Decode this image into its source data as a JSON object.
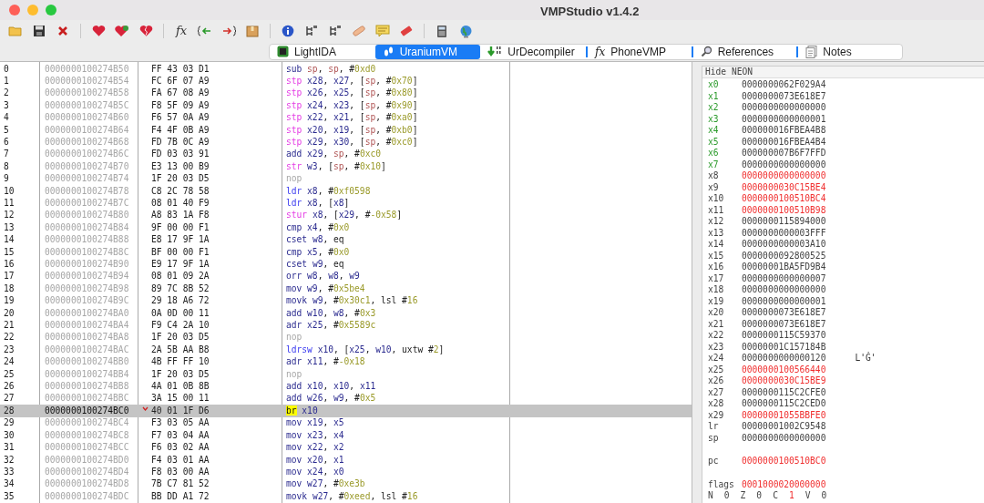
{
  "window": {
    "title": "VMPStudio v1.4.2"
  },
  "toolbar": [
    [
      {
        "kind": "folder"
      },
      {
        "kind": "save"
      },
      {
        "kind": "close"
      }
    ],
    [
      {
        "kind": "heart"
      },
      {
        "kind": "heart-flower"
      },
      {
        "kind": "heart-broken"
      }
    ],
    [
      {
        "kind": "fx",
        "label": "fx"
      },
      {
        "kind": "brace-left"
      },
      {
        "kind": "brace-right"
      },
      {
        "kind": "box"
      }
    ],
    [
      {
        "kind": "info"
      },
      {
        "kind": "tree"
      },
      {
        "kind": "tree"
      },
      {
        "kind": "bandage"
      },
      {
        "kind": "note"
      },
      {
        "kind": "eraser"
      }
    ],
    [
      {
        "kind": "calculator"
      },
      {
        "kind": "globe"
      }
    ]
  ],
  "tabs": [
    {
      "label": "LightIDA",
      "selected": false
    },
    {
      "label": "UraniumVM",
      "selected": true
    },
    {
      "label": "UrDecompiler",
      "selected": false
    },
    {
      "label": "PhoneVMP",
      "icon_text": "fx",
      "selected": false
    },
    {
      "label": "References",
      "selected": false
    },
    {
      "label": "Notes",
      "selected": false
    }
  ],
  "rows": [
    {
      "index": "0",
      "address": "0000000100274B50",
      "bytes": "FF 43 03 D1",
      "mnemonic": "sub",
      "kind": "alu",
      "args": [
        {
          "kind": "sp",
          "text": "sp"
        },
        {
          "kind": "p",
          "text": ", "
        },
        {
          "kind": "sp",
          "text": "sp"
        },
        {
          "kind": "p",
          "text": ", #"
        },
        {
          "kind": "imm",
          "text": "0xd0"
        }
      ],
      "selected": false
    },
    {
      "index": "1",
      "address": "0000000100274B54",
      "bytes": "FC 6F 07 A9",
      "mnemonic": "stp",
      "kind": "store",
      "args": [
        {
          "kind": "reg",
          "text": "x28"
        },
        {
          "kind": "p",
          "text": ", "
        },
        {
          "kind": "reg",
          "text": "x27"
        },
        {
          "kind": "p",
          "text": ", ["
        },
        {
          "kind": "sp",
          "text": "sp"
        },
        {
          "kind": "p",
          "text": ", #"
        },
        {
          "kind": "imm",
          "text": "0x70"
        },
        {
          "kind": "p",
          "text": "]"
        }
      ],
      "selected": false
    },
    {
      "index": "2",
      "address": "0000000100274B58",
      "bytes": "FA 67 08 A9",
      "mnemonic": "stp",
      "kind": "store",
      "args": [
        {
          "kind": "reg",
          "text": "x26"
        },
        {
          "kind": "p",
          "text": ", "
        },
        {
          "kind": "reg",
          "text": "x25"
        },
        {
          "kind": "p",
          "text": ", ["
        },
        {
          "kind": "sp",
          "text": "sp"
        },
        {
          "kind": "p",
          "text": ", #"
        },
        {
          "kind": "imm",
          "text": "0x80"
        },
        {
          "kind": "p",
          "text": "]"
        }
      ],
      "selected": false
    },
    {
      "index": "3",
      "address": "0000000100274B5C",
      "bytes": "F8 5F 09 A9",
      "mnemonic": "stp",
      "kind": "store",
      "args": [
        {
          "kind": "reg",
          "text": "x24"
        },
        {
          "kind": "p",
          "text": ", "
        },
        {
          "kind": "reg",
          "text": "x23"
        },
        {
          "kind": "p",
          "text": ", ["
        },
        {
          "kind": "sp",
          "text": "sp"
        },
        {
          "kind": "p",
          "text": ", #"
        },
        {
          "kind": "imm",
          "text": "0x90"
        },
        {
          "kind": "p",
          "text": "]"
        }
      ],
      "selected": false
    },
    {
      "index": "4",
      "address": "0000000100274B60",
      "bytes": "F6 57 0A A9",
      "mnemonic": "stp",
      "kind": "store",
      "args": [
        {
          "kind": "reg",
          "text": "x22"
        },
        {
          "kind": "p",
          "text": ", "
        },
        {
          "kind": "reg",
          "text": "x21"
        },
        {
          "kind": "p",
          "text": ", ["
        },
        {
          "kind": "sp",
          "text": "sp"
        },
        {
          "kind": "p",
          "text": ", #"
        },
        {
          "kind": "imm",
          "text": "0xa0"
        },
        {
          "kind": "p",
          "text": "]"
        }
      ],
      "selected": false
    },
    {
      "index": "5",
      "address": "0000000100274B64",
      "bytes": "F4 4F 0B A9",
      "mnemonic": "stp",
      "kind": "store",
      "args": [
        {
          "kind": "reg",
          "text": "x20"
        },
        {
          "kind": "p",
          "text": ", "
        },
        {
          "kind": "reg",
          "text": "x19"
        },
        {
          "kind": "p",
          "text": ", ["
        },
        {
          "kind": "sp",
          "text": "sp"
        },
        {
          "kind": "p",
          "text": ", #"
        },
        {
          "kind": "imm",
          "text": "0xb0"
        },
        {
          "kind": "p",
          "text": "]"
        }
      ],
      "selected": false
    },
    {
      "index": "6",
      "address": "0000000100274B68",
      "bytes": "FD 7B 0C A9",
      "mnemonic": "stp",
      "kind": "store",
      "args": [
        {
          "kind": "reg",
          "text": "x29"
        },
        {
          "kind": "p",
          "text": ", "
        },
        {
          "kind": "reg",
          "text": "x30"
        },
        {
          "kind": "p",
          "text": ", ["
        },
        {
          "kind": "sp",
          "text": "sp"
        },
        {
          "kind": "p",
          "text": ", #"
        },
        {
          "kind": "imm",
          "text": "0xc0"
        },
        {
          "kind": "p",
          "text": "]"
        }
      ],
      "selected": false
    },
    {
      "index": "7",
      "address": "0000000100274B6C",
      "bytes": "FD 03 03 91",
      "mnemonic": "add",
      "kind": "alu",
      "args": [
        {
          "kind": "reg",
          "text": "x29"
        },
        {
          "kind": "p",
          "text": ", "
        },
        {
          "kind": "sp",
          "text": "sp"
        },
        {
          "kind": "p",
          "text": ", #"
        },
        {
          "kind": "imm",
          "text": "0xc0"
        }
      ],
      "selected": false
    },
    {
      "index": "8",
      "address": "0000000100274B70",
      "bytes": "E3 13 00 B9",
      "mnemonic": "str",
      "kind": "store",
      "args": [
        {
          "kind": "reg",
          "text": "w3"
        },
        {
          "kind": "p",
          "text": ", ["
        },
        {
          "kind": "sp",
          "text": "sp"
        },
        {
          "kind": "p",
          "text": ", #"
        },
        {
          "kind": "imm",
          "text": "0x10"
        },
        {
          "kind": "p",
          "text": "]"
        }
      ],
      "selected": false
    },
    {
      "index": "9",
      "address": "0000000100274B74",
      "bytes": "1F 20 03 D5",
      "mnemonic": "nop",
      "kind": "nop",
      "args": [],
      "selected": false
    },
    {
      "index": "10",
      "address": "0000000100274B78",
      "bytes": "C8 2C 78 58",
      "mnemonic": "ldr",
      "kind": "load",
      "args": [
        {
          "kind": "reg",
          "text": "x8"
        },
        {
          "kind": "p",
          "text": ", #"
        },
        {
          "kind": "imm",
          "text": "0xf0598"
        }
      ],
      "selected": false
    },
    {
      "index": "11",
      "address": "0000000100274B7C",
      "bytes": "08 01 40 F9",
      "mnemonic": "ldr",
      "kind": "load",
      "args": [
        {
          "kind": "reg",
          "text": "x8"
        },
        {
          "kind": "p",
          "text": ", ["
        },
        {
          "kind": "reg",
          "text": "x8"
        },
        {
          "kind": "p",
          "text": "]"
        }
      ],
      "selected": false
    },
    {
      "index": "12",
      "address": "0000000100274B80",
      "bytes": "A8 83 1A F8",
      "mnemonic": "stur",
      "kind": "store",
      "args": [
        {
          "kind": "reg",
          "text": "x8"
        },
        {
          "kind": "p",
          "text": ", ["
        },
        {
          "kind": "reg",
          "text": "x29"
        },
        {
          "kind": "p",
          "text": ", #"
        },
        {
          "kind": "imm",
          "text": "-0x58"
        },
        {
          "kind": "p",
          "text": "]"
        }
      ],
      "selected": false
    },
    {
      "index": "13",
      "address": "0000000100274B84",
      "bytes": "9F 00 00 F1",
      "mnemonic": "cmp",
      "kind": "alu",
      "args": [
        {
          "kind": "reg",
          "text": "x4"
        },
        {
          "kind": "p",
          "text": ", #"
        },
        {
          "kind": "imm",
          "text": "0x0"
        }
      ],
      "selected": false
    },
    {
      "index": "14",
      "address": "0000000100274B88",
      "bytes": "E8 17 9F 1A",
      "mnemonic": "cset",
      "kind": "alu",
      "args": [
        {
          "kind": "reg",
          "text": "w8"
        },
        {
          "kind": "p",
          "text": ", eq"
        }
      ],
      "selected": false
    },
    {
      "index": "15",
      "address": "0000000100274B8C",
      "bytes": "BF 00 00 F1",
      "mnemonic": "cmp",
      "kind": "alu",
      "args": [
        {
          "kind": "reg",
          "text": "x5"
        },
        {
          "kind": "p",
          "text": ", #"
        },
        {
          "kind": "imm",
          "text": "0x0"
        }
      ],
      "selected": false
    },
    {
      "index": "16",
      "address": "0000000100274B90",
      "bytes": "E9 17 9F 1A",
      "mnemonic": "cset",
      "kind": "alu",
      "args": [
        {
          "kind": "reg",
          "text": "w9"
        },
        {
          "kind": "p",
          "text": ", eq"
        }
      ],
      "selected": false
    },
    {
      "index": "17",
      "address": "0000000100274B94",
      "bytes": "08 01 09 2A",
      "mnemonic": "orr",
      "kind": "alu",
      "args": [
        {
          "kind": "reg",
          "text": "w8"
        },
        {
          "kind": "p",
          "text": ", "
        },
        {
          "kind": "reg",
          "text": "w8"
        },
        {
          "kind": "p",
          "text": ", "
        },
        {
          "kind": "reg",
          "text": "w9"
        }
      ],
      "selected": false
    },
    {
      "index": "18",
      "address": "0000000100274B98",
      "bytes": "89 7C 8B 52",
      "mnemonic": "mov",
      "kind": "alu",
      "args": [
        {
          "kind": "reg",
          "text": "w9"
        },
        {
          "kind": "p",
          "text": ", #"
        },
        {
          "kind": "imm",
          "text": "0x5be4"
        }
      ],
      "selected": false
    },
    {
      "index": "19",
      "address": "0000000100274B9C",
      "bytes": "29 18 A6 72",
      "mnemonic": "movk",
      "kind": "alu",
      "args": [
        {
          "kind": "reg",
          "text": "w9"
        },
        {
          "kind": "p",
          "text": ", #"
        },
        {
          "kind": "imm",
          "text": "0x30c1"
        },
        {
          "kind": "p",
          "text": ", lsl #"
        },
        {
          "kind": "imm",
          "text": "16"
        }
      ],
      "selected": false
    },
    {
      "index": "20",
      "address": "0000000100274BA0",
      "bytes": "0A 0D 00 11",
      "mnemonic": "add",
      "kind": "alu",
      "args": [
        {
          "kind": "reg",
          "text": "w10"
        },
        {
          "kind": "p",
          "text": ", "
        },
        {
          "kind": "reg",
          "text": "w8"
        },
        {
          "kind": "p",
          "text": ", #"
        },
        {
          "kind": "imm",
          "text": "0x3"
        }
      ],
      "selected": false
    },
    {
      "index": "21",
      "address": "0000000100274BA4",
      "bytes": "F9 C4 2A 10",
      "mnemonic": "adr",
      "kind": "alu",
      "args": [
        {
          "kind": "reg",
          "text": "x25"
        },
        {
          "kind": "p",
          "text": ", #"
        },
        {
          "kind": "imm",
          "text": "0x5589c"
        }
      ],
      "selected": false
    },
    {
      "index": "22",
      "address": "0000000100274BA8",
      "bytes": "1F 20 03 D5",
      "mnemonic": "nop",
      "kind": "nop",
      "args": [],
      "selected": false
    },
    {
      "index": "23",
      "address": "0000000100274BAC",
      "bytes": "2A 5B AA B8",
      "mnemonic": "ldrsw",
      "kind": "load",
      "args": [
        {
          "kind": "reg",
          "text": "x10"
        },
        {
          "kind": "p",
          "text": ", ["
        },
        {
          "kind": "reg",
          "text": "x25"
        },
        {
          "kind": "p",
          "text": ", "
        },
        {
          "kind": "reg",
          "text": "w10"
        },
        {
          "kind": "p",
          "text": ", uxtw #"
        },
        {
          "kind": "imm",
          "text": "2"
        },
        {
          "kind": "p",
          "text": "]"
        }
      ],
      "selected": false
    },
    {
      "index": "24",
      "address": "0000000100274BB0",
      "bytes": "4B FF FF 10",
      "mnemonic": "adr",
      "kind": "alu",
      "args": [
        {
          "kind": "reg",
          "text": "x11"
        },
        {
          "kind": "p",
          "text": ", #"
        },
        {
          "kind": "imm",
          "text": "-0x18"
        }
      ],
      "selected": false
    },
    {
      "index": "25",
      "address": "0000000100274BB4",
      "bytes": "1F 20 03 D5",
      "mnemonic": "nop",
      "kind": "nop",
      "args": [],
      "selected": false
    },
    {
      "index": "26",
      "address": "0000000100274BB8",
      "bytes": "4A 01 0B 8B",
      "mnemonic": "add",
      "kind": "alu",
      "args": [
        {
          "kind": "reg",
          "text": "x10"
        },
        {
          "kind": "p",
          "text": ", "
        },
        {
          "kind": "reg",
          "text": "x10"
        },
        {
          "kind": "p",
          "text": ", "
        },
        {
          "kind": "reg",
          "text": "x11"
        }
      ],
      "selected": false
    },
    {
      "index": "27",
      "address": "0000000100274BBC",
      "bytes": "3A 15 00 11",
      "mnemonic": "add",
      "kind": "alu",
      "args": [
        {
          "kind": "reg",
          "text": "w26"
        },
        {
          "kind": "p",
          "text": ", "
        },
        {
          "kind": "reg",
          "text": "w9"
        },
        {
          "kind": "p",
          "text": ", #"
        },
        {
          "kind": "imm",
          "text": "0x5"
        }
      ],
      "selected": false
    },
    {
      "index": "28",
      "address": "0000000100274BC0",
      "bytes": "40 01 1F D6",
      "mnemonic": "br",
      "kind": "branch",
      "args": [
        {
          "kind": "reg",
          "text": "x10"
        }
      ],
      "selected": true
    },
    {
      "index": "29",
      "address": "0000000100274BC4",
      "bytes": "F3 03 05 AA",
      "mnemonic": "mov",
      "kind": "alu",
      "args": [
        {
          "kind": "reg",
          "text": "x19"
        },
        {
          "kind": "p",
          "text": ", "
        },
        {
          "kind": "reg",
          "text": "x5"
        }
      ],
      "selected": false
    },
    {
      "index": "30",
      "address": "0000000100274BC8",
      "bytes": "F7 03 04 AA",
      "mnemonic": "mov",
      "kind": "alu",
      "args": [
        {
          "kind": "reg",
          "text": "x23"
        },
        {
          "kind": "p",
          "text": ", "
        },
        {
          "kind": "reg",
          "text": "x4"
        }
      ],
      "selected": false
    },
    {
      "index": "31",
      "address": "0000000100274BCC",
      "bytes": "F6 03 02 AA",
      "mnemonic": "mov",
      "kind": "alu",
      "args": [
        {
          "kind": "reg",
          "text": "x22"
        },
        {
          "kind": "p",
          "text": ", "
        },
        {
          "kind": "reg",
          "text": "x2"
        }
      ],
      "selected": false
    },
    {
      "index": "32",
      "address": "0000000100274BD0",
      "bytes": "F4 03 01 AA",
      "mnemonic": "mov",
      "kind": "alu",
      "args": [
        {
          "kind": "reg",
          "text": "x20"
        },
        {
          "kind": "p",
          "text": ", "
        },
        {
          "kind": "reg",
          "text": "x1"
        }
      ],
      "selected": false
    },
    {
      "index": "33",
      "address": "0000000100274BD4",
      "bytes": "F8 03 00 AA",
      "mnemonic": "mov",
      "kind": "alu",
      "args": [
        {
          "kind": "reg",
          "text": "x24"
        },
        {
          "kind": "p",
          "text": ", "
        },
        {
          "kind": "reg",
          "text": "x0"
        }
      ],
      "selected": false
    },
    {
      "index": "34",
      "address": "0000000100274BD8",
      "bytes": "7B C7 81 52",
      "mnemonic": "mov",
      "kind": "alu",
      "args": [
        {
          "kind": "reg",
          "text": "w27"
        },
        {
          "kind": "p",
          "text": ", #"
        },
        {
          "kind": "imm",
          "text": "0xe3b"
        }
      ],
      "selected": false
    },
    {
      "index": "35",
      "address": "0000000100274BDC",
      "bytes": "BB DD A1 72",
      "mnemonic": "movk",
      "kind": "alu",
      "args": [
        {
          "kind": "reg",
          "text": "w27"
        },
        {
          "kind": "p",
          "text": ", #"
        },
        {
          "kind": "imm",
          "text": "0xeed"
        },
        {
          "kind": "p",
          "text": ", lsl #"
        },
        {
          "kind": "imm",
          "text": "16"
        }
      ],
      "selected": false
    }
  ],
  "registers_panel": {
    "header": "Hide NEON",
    "registers": [
      {
        "name": "x0",
        "value": "0000000062F029A4",
        "argument": true,
        "changed": false
      },
      {
        "name": "x1",
        "value": "0000000073E618E7",
        "argument": true,
        "changed": false
      },
      {
        "name": "x2",
        "value": "0000000000000000",
        "argument": true,
        "changed": false
      },
      {
        "name": "x3",
        "value": "0000000000000001",
        "argument": true,
        "changed": false
      },
      {
        "name": "x4",
        "value": "000000016FBEA4B8",
        "argument": true,
        "changed": false
      },
      {
        "name": "x5",
        "value": "000000016FBEA4B4",
        "argument": true,
        "changed": false
      },
      {
        "name": "x6",
        "value": "000000007B6F7FFD",
        "argument": true,
        "changed": false
      },
      {
        "name": "x7",
        "value": "0000000000000000",
        "argument": true,
        "changed": false
      },
      {
        "name": "x8",
        "value": "0000000000000000",
        "argument": false,
        "changed": true
      },
      {
        "name": "x9",
        "value": "0000000030C15BE4",
        "argument": false,
        "changed": true
      },
      {
        "name": "x10",
        "value": "0000000100510BC4",
        "argument": false,
        "changed": true
      },
      {
        "name": "x11",
        "value": "0000000100510B98",
        "argument": false,
        "changed": true
      },
      {
        "name": "x12",
        "value": "0000000115894000",
        "argument": false,
        "changed": false
      },
      {
        "name": "x13",
        "value": "0000000000003FFF",
        "argument": false,
        "changed": false
      },
      {
        "name": "x14",
        "value": "0000000000003A10",
        "argument": false,
        "changed": false
      },
      {
        "name": "x15",
        "value": "0000000092800525",
        "argument": false,
        "changed": false
      },
      {
        "name": "x16",
        "value": "00000001BA5FD9B4",
        "argument": false,
        "changed": false
      },
      {
        "name": "x17",
        "value": "0000000000000007",
        "argument": false,
        "changed": false
      },
      {
        "name": "x18",
        "value": "0000000000000000",
        "argument": false,
        "changed": false
      },
      {
        "name": "x19",
        "value": "0000000000000001",
        "argument": false,
        "changed": false
      },
      {
        "name": "x20",
        "value": "0000000073E618E7",
        "argument": false,
        "changed": false
      },
      {
        "name": "x21",
        "value": "0000000073E618E7",
        "argument": false,
        "changed": false
      },
      {
        "name": "x22",
        "value": "0000000115C59370",
        "argument": false,
        "changed": false
      },
      {
        "name": "x23",
        "value": "00000001C157184B",
        "argument": false,
        "changed": false
      },
      {
        "name": "x24",
        "value": "0000000000000120",
        "argument": false,
        "changed": false,
        "note": "L'Ġ'"
      },
      {
        "name": "x25",
        "value": "0000000100566440",
        "argument": false,
        "changed": true
      },
      {
        "name": "x26",
        "value": "0000000030C15BE9",
        "argument": false,
        "changed": true
      },
      {
        "name": "x27",
        "value": "0000000115C2CFE0",
        "argument": false,
        "changed": false
      },
      {
        "name": "x28",
        "value": "0000000115C2CED0",
        "argument": false,
        "changed": false
      },
      {
        "name": "x29",
        "value": "00000001055BBFE0",
        "argument": false,
        "changed": true
      },
      {
        "name": "lr",
        "value": "00000001002C9548",
        "argument": false,
        "changed": false
      },
      {
        "name": "sp",
        "value": "0000000000000000",
        "argument": false,
        "changed": false
      }
    ],
    "pc": {
      "name": "pc",
      "value": "0000000100510BC0",
      "changed": true
    },
    "flags": {
      "name": "flags",
      "value": "0001000020000000",
      "changed": true
    },
    "flag_bits": [
      {
        "name": "N",
        "value": "0",
        "changed": false
      },
      {
        "name": "Z",
        "value": "0",
        "changed": false
      },
      {
        "name": "C",
        "value": "1",
        "changed": true
      },
      {
        "name": "V",
        "value": "0",
        "changed": false
      }
    ]
  }
}
